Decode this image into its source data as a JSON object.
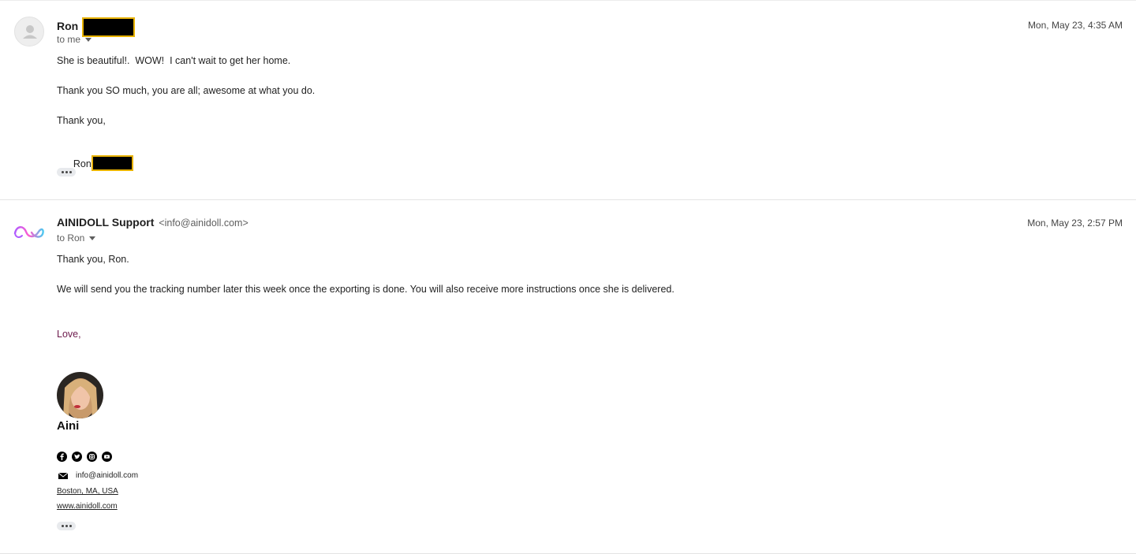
{
  "messages": [
    {
      "sender_name": "Ron",
      "recipient": "to me",
      "date": "Mon, May 23, 4:35 AM",
      "body": [
        "She is beautiful!.  WOW!  I can't wait to get her home.",
        "Thank you SO much, you are all; awesome at what you do.",
        "Thank you,"
      ],
      "signoff": "Ron"
    },
    {
      "sender_name": "AINIDOLL Support",
      "sender_email": "<info@ainidoll.com>",
      "recipient": "to Ron",
      "date": "Mon, May 23, 2:57 PM",
      "body": [
        "Thank you, Ron.",
        "We will send you the tracking number later this week once the exporting is done. You will also receive more instructions once she is delivered."
      ],
      "closing": "Love,",
      "signature": {
        "name": "Aini",
        "email": "info@ainidoll.com",
        "location": "Boston, MA, USA",
        "website": "www.ainidoll.com",
        "social_icons": [
          "facebook-icon",
          "twitter-icon",
          "instagram-icon",
          "youtube-icon"
        ]
      }
    }
  ],
  "colors": {
    "redaction_border": "#e8b200",
    "closing_text": "#6d1a4c",
    "logo_gradient_start": "#b05cff",
    "logo_gradient_end": "#4cc9f0"
  }
}
